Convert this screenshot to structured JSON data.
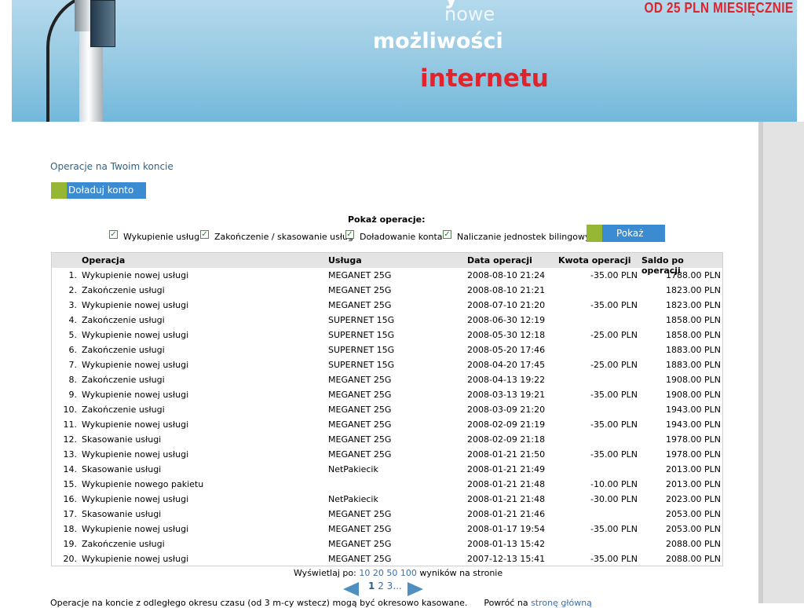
{
  "banner": {
    "word_top": "y",
    "word1": "nowe",
    "word2": "możliwości",
    "word3": "internetu",
    "promo": "OD 25 PLN MIESIĘCZNIE"
  },
  "section_title": "Operacje na Twoim koncie",
  "topup_label": "Doładuj konto",
  "filters": {
    "title": "Pokaż operacje:",
    "options": [
      {
        "label": "Wykupienie usług",
        "checked": true
      },
      {
        "label": "Zakończenie / skasowanie usług",
        "checked": true
      },
      {
        "label": "Doładowanie konta",
        "checked": true
      },
      {
        "label": "Naliczanie jednostek bilingowych",
        "checked": true
      }
    ],
    "show_label": "Pokaż"
  },
  "table": {
    "headers": [
      "Operacja",
      "Usługa",
      "Data operacji",
      "Kwota operacji",
      "Saldo po operacji"
    ],
    "rows": [
      {
        "num": "1.",
        "op": "Wykupienie nowej usługi",
        "svc": "MEGANET 25G",
        "date": "2008-08-10 21:24",
        "amt": "-35.00 PLN",
        "bal": "1788.00 PLN"
      },
      {
        "num": "2.",
        "op": "Zakończenie usługi",
        "svc": "MEGANET 25G",
        "date": "2008-08-10 21:21",
        "amt": "",
        "bal": "1823.00 PLN"
      },
      {
        "num": "3.",
        "op": "Wykupienie nowej usługi",
        "svc": "MEGANET 25G",
        "date": "2008-07-10 21:20",
        "amt": "-35.00 PLN",
        "bal": "1823.00 PLN"
      },
      {
        "num": "4.",
        "op": "Zakończenie usługi",
        "svc": "SUPERNET 15G",
        "date": "2008-06-30 12:19",
        "amt": "",
        "bal": "1858.00 PLN"
      },
      {
        "num": "5.",
        "op": "Wykupienie nowej usługi",
        "svc": "SUPERNET 15G",
        "date": "2008-05-30 12:18",
        "amt": "-25.00 PLN",
        "bal": "1858.00 PLN"
      },
      {
        "num": "6.",
        "op": "Zakończenie usługi",
        "svc": "SUPERNET 15G",
        "date": "2008-05-20 17:46",
        "amt": "",
        "bal": "1883.00 PLN"
      },
      {
        "num": "7.",
        "op": "Wykupienie nowej usługi",
        "svc": "SUPERNET 15G",
        "date": "2008-04-20 17:45",
        "amt": "-25.00 PLN",
        "bal": "1883.00 PLN"
      },
      {
        "num": "8.",
        "op": "Zakończenie usługi",
        "svc": "MEGANET 25G",
        "date": "2008-04-13 19:22",
        "amt": "",
        "bal": "1908.00 PLN"
      },
      {
        "num": "9.",
        "op": "Wykupienie nowej usługi",
        "svc": "MEGANET 25G",
        "date": "2008-03-13 19:21",
        "amt": "-35.00 PLN",
        "bal": "1908.00 PLN"
      },
      {
        "num": "10.",
        "op": "Zakończenie usługi",
        "svc": "MEGANET 25G",
        "date": "2008-03-09 21:20",
        "amt": "",
        "bal": "1943.00 PLN"
      },
      {
        "num": "11.",
        "op": "Wykupienie nowej usługi",
        "svc": "MEGANET 25G",
        "date": "2008-02-09 21:19",
        "amt": "-35.00 PLN",
        "bal": "1943.00 PLN"
      },
      {
        "num": "12.",
        "op": "Skasowanie usługi",
        "svc": "MEGANET 25G",
        "date": "2008-02-09 21:18",
        "amt": "",
        "bal": "1978.00 PLN"
      },
      {
        "num": "13.",
        "op": "Wykupienie nowej usługi",
        "svc": "MEGANET 25G",
        "date": "2008-01-21 21:50",
        "amt": "-35.00 PLN",
        "bal": "1978.00 PLN"
      },
      {
        "num": "14.",
        "op": "Skasowanie usługi",
        "svc": "NetPakiecik",
        "date": "2008-01-21 21:49",
        "amt": "",
        "bal": "2013.00 PLN"
      },
      {
        "num": "15.",
        "op": "Wykupienie nowego pakietu",
        "svc": "",
        "date": "2008-01-21 21:48",
        "amt": "-10.00 PLN",
        "bal": "2013.00 PLN"
      },
      {
        "num": "16.",
        "op": "Wykupienie nowej usługi",
        "svc": "NetPakiecik",
        "date": "2008-01-21 21:48",
        "amt": "-30.00 PLN",
        "bal": "2023.00 PLN"
      },
      {
        "num": "17.",
        "op": "Skasowanie usługi",
        "svc": "MEGANET 25G",
        "date": "2008-01-21 21:46",
        "amt": "",
        "bal": "2053.00 PLN"
      },
      {
        "num": "18.",
        "op": "Wykupienie nowej usługi",
        "svc": "MEGANET 25G",
        "date": "2008-01-17 19:54",
        "amt": "-35.00 PLN",
        "bal": "2053.00 PLN"
      },
      {
        "num": "19.",
        "op": "Zakończenie usługi",
        "svc": "MEGANET 25G",
        "date": "2008-01-13 15:42",
        "amt": "",
        "bal": "2088.00 PLN"
      },
      {
        "num": "20.",
        "op": "Wykupienie nowej usługi",
        "svc": "MEGANET 25G",
        "date": "2007-12-13 15:41",
        "amt": "-35.00 PLN",
        "bal": "2088.00 PLN"
      }
    ]
  },
  "per_page": {
    "prefix": "Wyświetlaj po:",
    "options": [
      "10",
      "20",
      "50",
      "100"
    ],
    "suffix": "wyników na stronie"
  },
  "pager": {
    "current": "1",
    "pages": [
      "2",
      "3..."
    ]
  },
  "footer": {
    "note": "Operacje na koncie z odległego okresu czasu (od 3 m-cy wstecz) mogą być okresowo kasowane.",
    "back_prefix": "Powróć na",
    "back_link": "stronę główną"
  }
}
